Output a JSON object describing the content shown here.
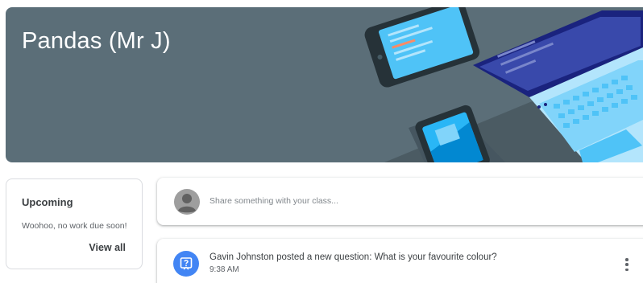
{
  "banner": {
    "title": "Pandas (Mr J)",
    "background_color": "#5b6e78"
  },
  "upcoming": {
    "title": "Upcoming",
    "message": "Woohoo, no work due soon!",
    "view_all_label": "View all"
  },
  "stream": {
    "share_placeholder": "Share something with your class...",
    "posts": [
      {
        "icon": "question-icon",
        "title": "Gavin Johnston posted a new question: What is your favourite colour?",
        "time": "9:38 AM",
        "icon_color": "#4285f4"
      }
    ]
  }
}
